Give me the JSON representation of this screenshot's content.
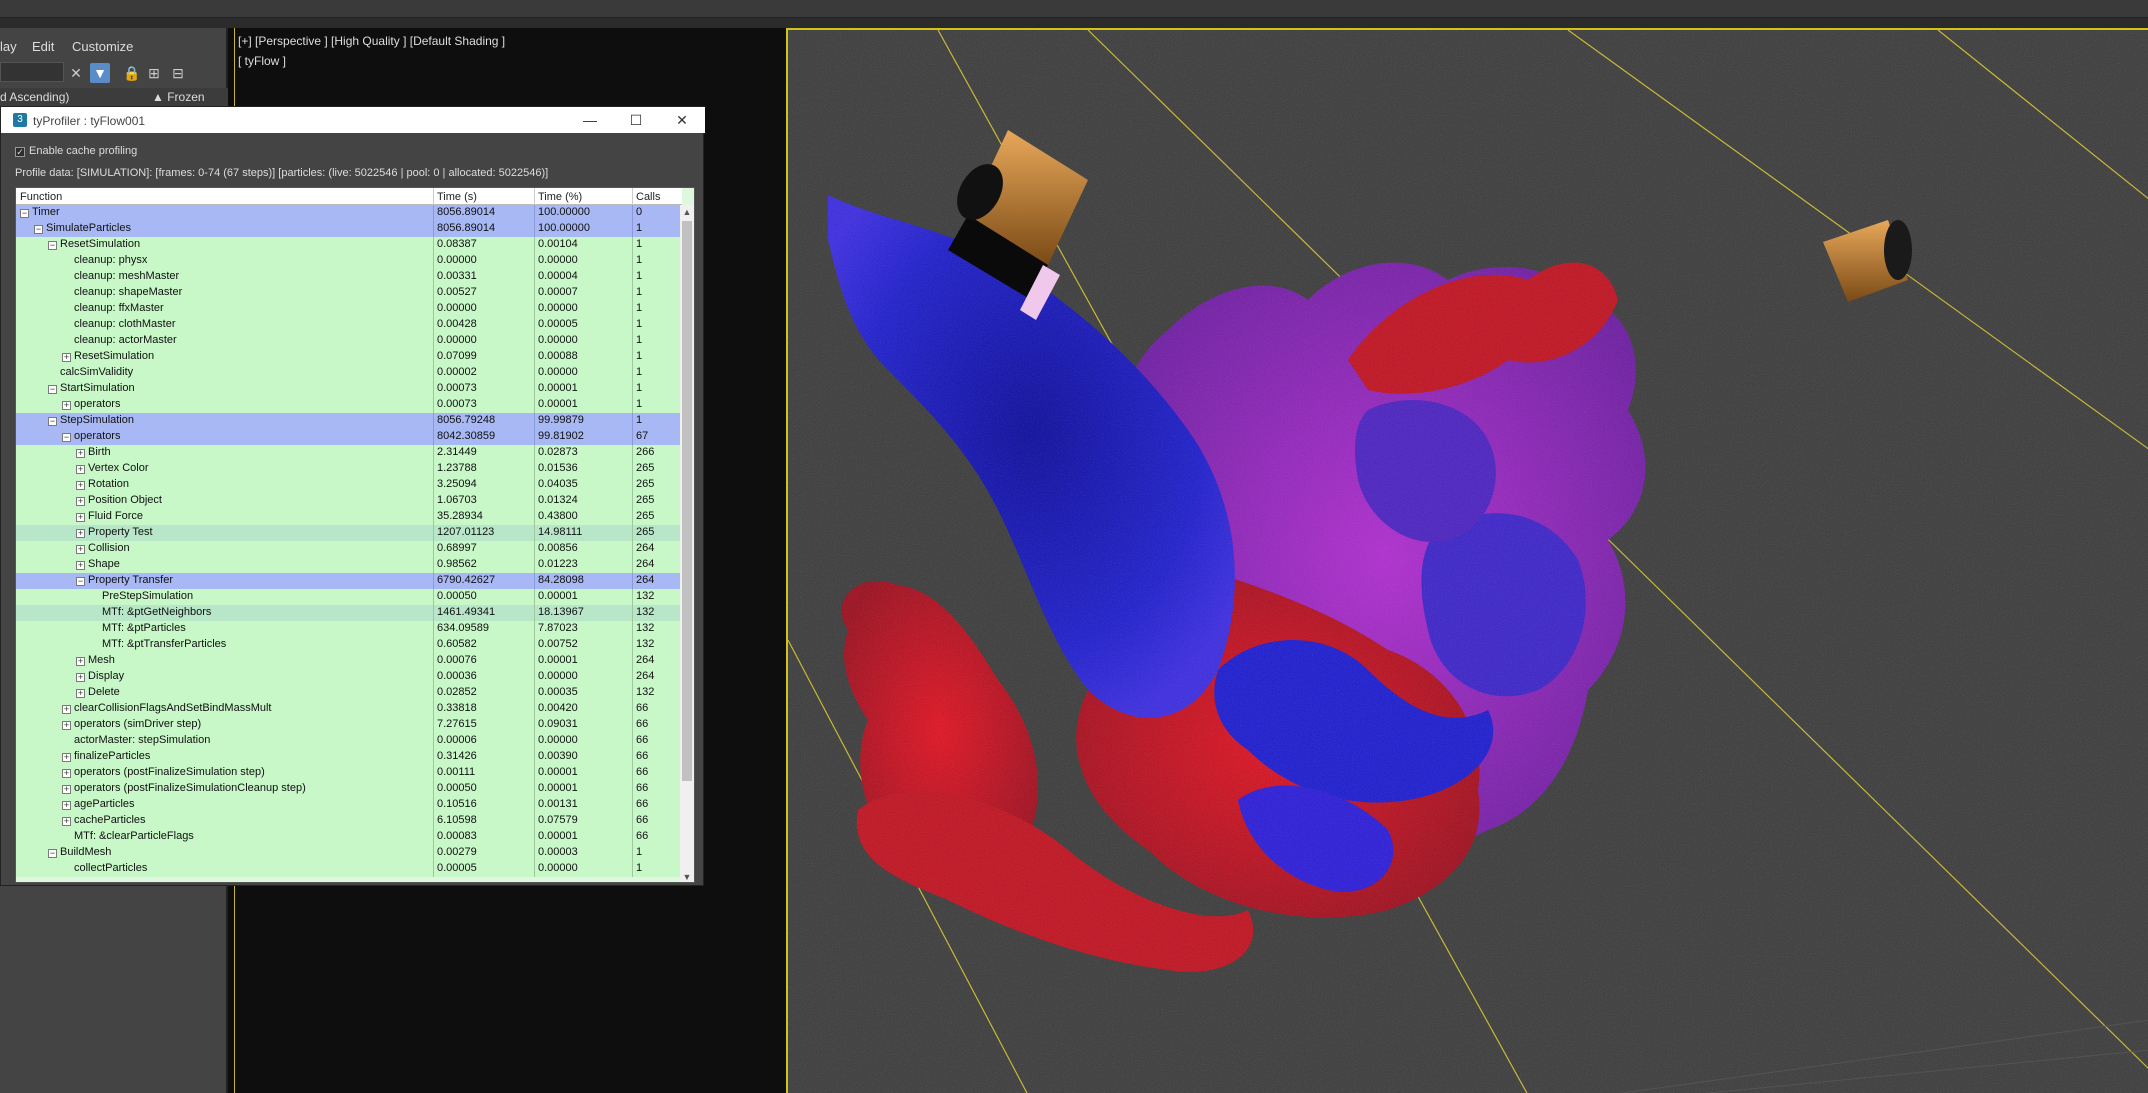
{
  "menu": {
    "display": "lay",
    "edit": "Edit",
    "customize": "Customize"
  },
  "explorer": {
    "sort_label": "d Ascending)",
    "frozen_label": "▲ Frozen"
  },
  "viewport": {
    "label": "[+] [Perspective ] [High Quality ] [Default Shading ]",
    "sublabel": "[ tyFlow ]"
  },
  "profiler": {
    "title": "tyProfiler : tyFlow001",
    "enable_cache_label": "Enable cache profiling",
    "enable_cache_checked": true,
    "profile_data": "Profile data:   [SIMULATION]: [frames: 0-74 (67 steps)] [particles: (live: 5022546 | pool: 0 | allocated: 5022546)]",
    "columns": {
      "function": "Function",
      "time_s": "Time (s)",
      "time_pct": "Time (%)",
      "calls": "Calls"
    },
    "rows": [
      {
        "depth": 0,
        "exp": "minus",
        "name": "Timer",
        "t": "8056.89014",
        "p": "100.00000",
        "c": "0",
        "style": "sel"
      },
      {
        "depth": 1,
        "exp": "minus",
        "name": "SimulateParticles",
        "t": "8056.89014",
        "p": "100.00000",
        "c": "1",
        "style": "sel"
      },
      {
        "depth": 2,
        "exp": "minus",
        "name": "ResetSimulation",
        "t": "0.08387",
        "p": "0.00104",
        "c": "1",
        "style": ""
      },
      {
        "depth": 3,
        "exp": "",
        "name": "cleanup: physx",
        "t": "0.00000",
        "p": "0.00000",
        "c": "1",
        "style": ""
      },
      {
        "depth": 3,
        "exp": "",
        "name": "cleanup: meshMaster",
        "t": "0.00331",
        "p": "0.00004",
        "c": "1",
        "style": ""
      },
      {
        "depth": 3,
        "exp": "",
        "name": "cleanup: shapeMaster",
        "t": "0.00527",
        "p": "0.00007",
        "c": "1",
        "style": ""
      },
      {
        "depth": 3,
        "exp": "",
        "name": "cleanup: ffxMaster",
        "t": "0.00000",
        "p": "0.00000",
        "c": "1",
        "style": ""
      },
      {
        "depth": 3,
        "exp": "",
        "name": "cleanup: clothMaster",
        "t": "0.00428",
        "p": "0.00005",
        "c": "1",
        "style": ""
      },
      {
        "depth": 3,
        "exp": "",
        "name": "cleanup: actorMaster",
        "t": "0.00000",
        "p": "0.00000",
        "c": "1",
        "style": ""
      },
      {
        "depth": 3,
        "exp": "plus",
        "name": "ResetSimulation",
        "t": "0.07099",
        "p": "0.00088",
        "c": "1",
        "style": ""
      },
      {
        "depth": 2,
        "exp": "",
        "name": "calcSimValidity",
        "t": "0.00002",
        "p": "0.00000",
        "c": "1",
        "style": ""
      },
      {
        "depth": 2,
        "exp": "minus",
        "name": "StartSimulation",
        "t": "0.00073",
        "p": "0.00001",
        "c": "1",
        "style": ""
      },
      {
        "depth": 3,
        "exp": "plus",
        "name": "operators",
        "t": "0.00073",
        "p": "0.00001",
        "c": "1",
        "style": ""
      },
      {
        "depth": 2,
        "exp": "minus",
        "name": "StepSimulation",
        "t": "8056.79248",
        "p": "99.99879",
        "c": "1",
        "style": "sel"
      },
      {
        "depth": 3,
        "exp": "minus",
        "name": "operators",
        "t": "8042.30859",
        "p": "99.81902",
        "c": "67",
        "style": "sel"
      },
      {
        "depth": 4,
        "exp": "plus",
        "name": "Birth",
        "t": "2.31449",
        "p": "0.02873",
        "c": "266",
        "style": ""
      },
      {
        "depth": 4,
        "exp": "plus",
        "name": "Vertex Color",
        "t": "1.23788",
        "p": "0.01536",
        "c": "265",
        "style": ""
      },
      {
        "depth": 4,
        "exp": "plus",
        "name": "Rotation",
        "t": "3.25094",
        "p": "0.04035",
        "c": "265",
        "style": ""
      },
      {
        "depth": 4,
        "exp": "plus",
        "name": "Position Object",
        "t": "1.06703",
        "p": "0.01324",
        "c": "265",
        "style": ""
      },
      {
        "depth": 4,
        "exp": "plus",
        "name": "Fluid Force",
        "t": "35.28934",
        "p": "0.43800",
        "c": "265",
        "style": ""
      },
      {
        "depth": 4,
        "exp": "plus",
        "name": "Property Test",
        "t": "1207.01123",
        "p": "14.98111",
        "c": "265",
        "style": "alt"
      },
      {
        "depth": 4,
        "exp": "plus",
        "name": "Collision",
        "t": "0.68997",
        "p": "0.00856",
        "c": "264",
        "style": ""
      },
      {
        "depth": 4,
        "exp": "plus",
        "name": "Shape",
        "t": "0.98562",
        "p": "0.01223",
        "c": "264",
        "style": ""
      },
      {
        "depth": 4,
        "exp": "minus",
        "name": "Property Transfer",
        "t": "6790.42627",
        "p": "84.28098",
        "c": "264",
        "style": "sel"
      },
      {
        "depth": 5,
        "exp": "",
        "name": "PreStepSimulation",
        "t": "0.00050",
        "p": "0.00001",
        "c": "132",
        "style": ""
      },
      {
        "depth": 5,
        "exp": "",
        "name": "MTf: &ptGetNeighbors",
        "t": "1461.49341",
        "p": "18.13967",
        "c": "132",
        "style": "alt"
      },
      {
        "depth": 5,
        "exp": "",
        "name": "MTf: &ptParticles",
        "t": "634.09589",
        "p": "7.87023",
        "c": "132",
        "style": ""
      },
      {
        "depth": 5,
        "exp": "",
        "name": "MTf: &ptTransferParticles",
        "t": "0.60582",
        "p": "0.00752",
        "c": "132",
        "style": ""
      },
      {
        "depth": 4,
        "exp": "plus",
        "name": "Mesh",
        "t": "0.00076",
        "p": "0.00001",
        "c": "264",
        "style": ""
      },
      {
        "depth": 4,
        "exp": "plus",
        "name": "Display",
        "t": "0.00036",
        "p": "0.00000",
        "c": "264",
        "style": ""
      },
      {
        "depth": 4,
        "exp": "plus",
        "name": "Delete",
        "t": "0.02852",
        "p": "0.00035",
        "c": "132",
        "style": ""
      },
      {
        "depth": 3,
        "exp": "plus",
        "name": "clearCollisionFlagsAndSetBindMassMult",
        "t": "0.33818",
        "p": "0.00420",
        "c": "66",
        "style": ""
      },
      {
        "depth": 3,
        "exp": "plus",
        "name": "operators (simDriver step)",
        "t": "7.27615",
        "p": "0.09031",
        "c": "66",
        "style": ""
      },
      {
        "depth": 3,
        "exp": "",
        "name": "actorMaster: stepSimulation",
        "t": "0.00006",
        "p": "0.00000",
        "c": "66",
        "style": ""
      },
      {
        "depth": 3,
        "exp": "plus",
        "name": "finalizeParticles",
        "t": "0.31426",
        "p": "0.00390",
        "c": "66",
        "style": ""
      },
      {
        "depth": 3,
        "exp": "plus",
        "name": "operators (postFinalizeSimulation step)",
        "t": "0.00111",
        "p": "0.00001",
        "c": "66",
        "style": ""
      },
      {
        "depth": 3,
        "exp": "plus",
        "name": "operators (postFinalizeSimulationCleanup step)",
        "t": "0.00050",
        "p": "0.00001",
        "c": "66",
        "style": ""
      },
      {
        "depth": 3,
        "exp": "plus",
        "name": "ageParticles",
        "t": "0.10516",
        "p": "0.00131",
        "c": "66",
        "style": ""
      },
      {
        "depth": 3,
        "exp": "plus",
        "name": "cacheParticles",
        "t": "6.10598",
        "p": "0.07579",
        "c": "66",
        "style": ""
      },
      {
        "depth": 3,
        "exp": "",
        "name": "MTf: &clearParticleFlags",
        "t": "0.00083",
        "p": "0.00001",
        "c": "66",
        "style": ""
      },
      {
        "depth": 2,
        "exp": "minus",
        "name": "BuildMesh",
        "t": "0.00279",
        "p": "0.00003",
        "c": "1",
        "style": ""
      },
      {
        "depth": 3,
        "exp": "",
        "name": "collectParticles",
        "t": "0.00005",
        "p": "0.00000",
        "c": "1",
        "style": ""
      }
    ]
  },
  "colors": {
    "selected_row": "#a8b8f4",
    "normal_row": "#c8f7c8",
    "alt_row": "#b7e6c9",
    "viewport_border": "#d4c21a",
    "sim_blue": "#1a1ab4",
    "sim_red": "#c81018",
    "sim_purple": "#7a1aa8",
    "emitter_copper": "#c8893a"
  },
  "icons": [
    "close-icon",
    "lock-icon",
    "filter-icon",
    "hierarchy-icon",
    "minimize-icon",
    "maximize-icon",
    "app-icon"
  ]
}
